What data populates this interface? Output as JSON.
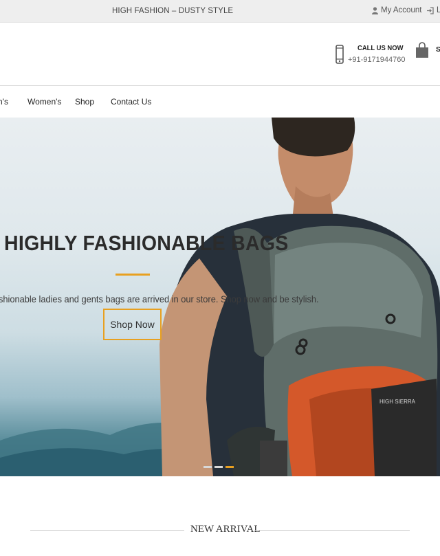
{
  "topbar": {
    "tagline": "HIGH FASHION – DUSTY STYLE",
    "account_label": "My Account",
    "login_label": "Lo"
  },
  "header": {
    "call_title": "CALL US NOW",
    "call_number": "+91-9171944760",
    "cart_label": "S"
  },
  "nav": {
    "items": [
      "n's",
      "Women's",
      "Shop",
      "Contact Us"
    ]
  },
  "hero": {
    "title": "HIGHLY FASHIONABLE BAGS",
    "subtitle": "shionable ladies and gents bags are arrived in our store. Shop now and be stylish.",
    "button_label": "Shop Now",
    "slides_total": 3,
    "active_slide": 3,
    "backpack_brand": "HIGH SIERRA"
  },
  "section": {
    "title": "NEW ARRIVAL"
  },
  "colors": {
    "accent": "#e8a020",
    "topbar_bg": "#eeeeee",
    "text": "#2b2b2b"
  },
  "icons": [
    "user-icon",
    "login-icon",
    "phone-icon",
    "shopping-bag-icon"
  ]
}
